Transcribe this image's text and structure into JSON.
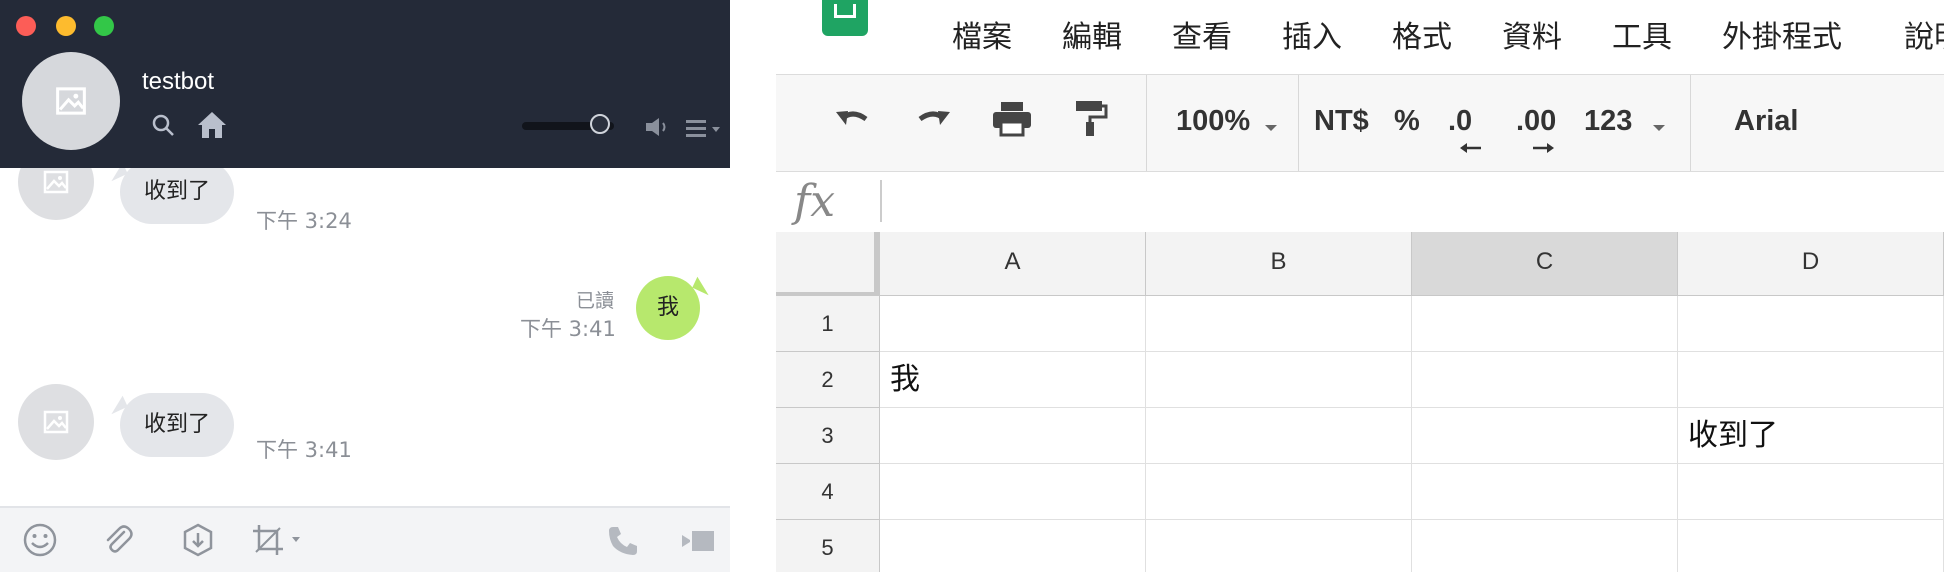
{
  "chat": {
    "title": "testbot",
    "messages": [
      {
        "direction": "in",
        "text": "收到了",
        "time": "下午 3:24"
      },
      {
        "direction": "out",
        "text": "我",
        "time": "下午 3:41",
        "status": "已讀"
      },
      {
        "direction": "in",
        "text": "收到了",
        "time": "下午 3:41"
      }
    ],
    "volume_level": 0.85,
    "colors": {
      "header": "#242a38",
      "out_bubble": "#b7e86d",
      "in_bubble": "#e4e6ea"
    }
  },
  "sheets": {
    "menu": [
      "檔案",
      "編輯",
      "查看",
      "插入",
      "格式",
      "資料",
      "工具",
      "外掛程式",
      "說明"
    ],
    "toolbar": {
      "zoom": "100%",
      "currency": "NT$",
      "percent": "%",
      "decrease_decimal": ".0",
      "increase_decimal": ".00",
      "more_formats": "123",
      "font": "Arial"
    },
    "formula_label": "fx",
    "columns": [
      "A",
      "B",
      "C",
      "D"
    ],
    "rows": [
      "1",
      "2",
      "3",
      "4",
      "5"
    ],
    "selected_column": "C",
    "cells": {
      "A2": "我",
      "D3": "收到了"
    },
    "colors": {
      "logo": "#1fa463"
    }
  }
}
